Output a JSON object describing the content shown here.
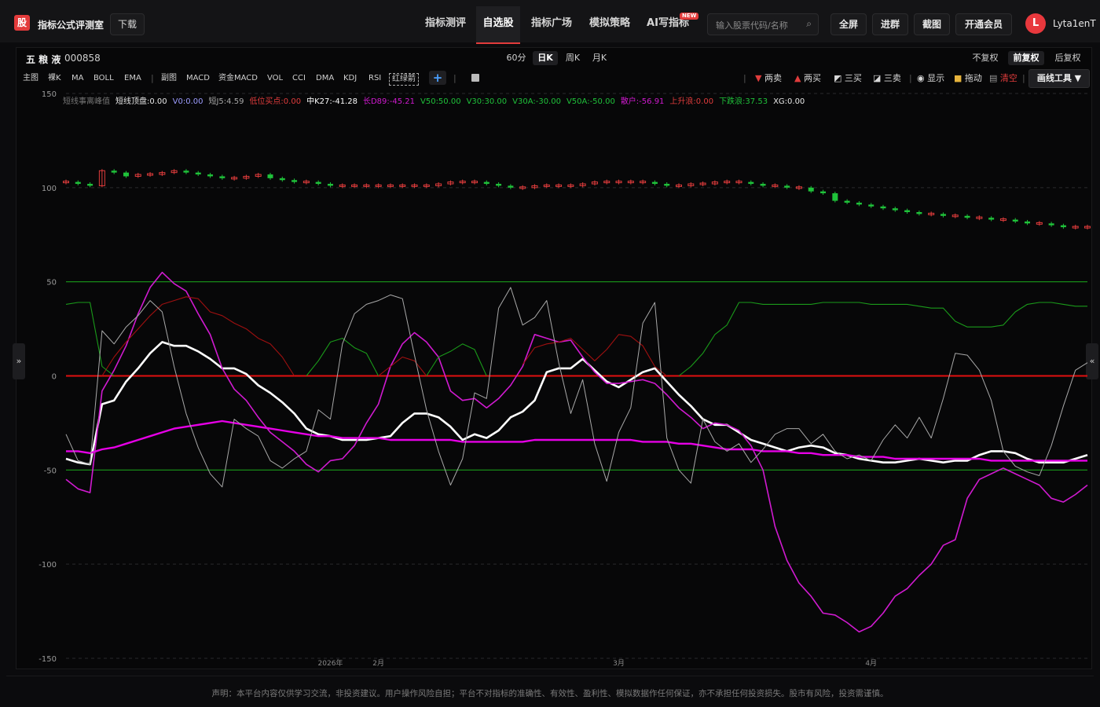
{
  "app": {
    "logo_char": "股",
    "title": "指标公式评测室",
    "download": "下载"
  },
  "nav": {
    "items": [
      "指标测评",
      "自选股",
      "指标广场",
      "模拟策略",
      "AI写指标"
    ],
    "active_index": 1,
    "new_badge": "NEW"
  },
  "search": {
    "placeholder": "输入股票代码/名称"
  },
  "toolbar": {
    "fullscreen": "全屏",
    "join_group": "进群",
    "screenshot": "截图",
    "membership": "开通会员"
  },
  "user": {
    "initial": "L",
    "name": "Lyta1enT"
  },
  "stock": {
    "name": "五 粮 液",
    "code": "000858"
  },
  "periods": {
    "items": [
      "60分",
      "日K",
      "周K",
      "月K"
    ],
    "active_index": 1
  },
  "adjust": {
    "items": [
      "不复权",
      "前复权",
      "后复权"
    ],
    "active_index": 1
  },
  "indicators": {
    "main": [
      "主图",
      "裸K",
      "MA",
      "BOLL",
      "EMA"
    ],
    "sub": [
      "副图",
      "MACD",
      "资金MACD",
      "VOL",
      "CCI",
      "DMA",
      "KDJ",
      "RSI",
      "红绿箭"
    ],
    "add": "+"
  },
  "tools": {
    "items": [
      "两卖",
      "两买",
      "三买",
      "三卖",
      "显示",
      "拖动",
      "清空"
    ],
    "draw": "画线工具 ▼"
  },
  "side": {
    "left": "»",
    "right": "«"
  },
  "colors": {
    "up": "#e03c3c",
    "down": "#1fc23a",
    "white": "#ffffff",
    "magenta": "#d01ad0",
    "pinkline": "#e600e6",
    "darkred": "#a01010",
    "green": "#1a9a1a",
    "grey": "#a8a8a8",
    "bg": "#070708"
  },
  "legend": [
    {
      "text": "短线事离峰值",
      "color": "#777777"
    },
    {
      "text": "短线顶盘:0.00",
      "color": "#e8e8e8"
    },
    {
      "text": "V0:0.00",
      "color": "#9d9dff"
    },
    {
      "text": "短J5:4.59",
      "color": "#a8a8a8"
    },
    {
      "text": "低位买点:0.00",
      "color": "#e03c3c"
    },
    {
      "text": "中K27:-41.28",
      "color": "#ffffff"
    },
    {
      "text": "长D89:-45.21",
      "color": "#d01ad0"
    },
    {
      "text": "V50:50.00",
      "color": "#1fc23a"
    },
    {
      "text": "V30:30.00",
      "color": "#1fc23a"
    },
    {
      "text": "V30A:-30.00",
      "color": "#1fc23a"
    },
    {
      "text": "V50A:-50.00",
      "color": "#1fc23a"
    },
    {
      "text": "散户:-56.91",
      "color": "#d01ad0"
    },
    {
      "text": "上升浪:0.00",
      "color": "#e03c3c"
    },
    {
      "text": "下跌浪:37.53",
      "color": "#1fc23a"
    },
    {
      "text": "XG:0.00",
      "color": "#e8e8e8"
    }
  ],
  "chart_data": {
    "type": "line",
    "ylim": [
      -150,
      150
    ],
    "yticks": [
      150,
      100,
      50,
      0,
      -50,
      -100,
      -150
    ],
    "xlabels": [
      "2026年",
      "2月",
      "3月",
      "4月"
    ],
    "xlabel_positions": [
      22,
      26,
      46,
      67
    ],
    "n": 75,
    "candles": [
      103,
      102,
      101,
      109,
      108,
      106,
      107,
      107,
      108,
      109,
      108,
      107,
      106,
      105,
      105,
      106,
      107,
      105,
      104,
      103,
      103,
      102,
      101,
      101,
      101,
      101,
      101,
      101,
      101,
      101,
      101,
      102,
      103,
      103,
      103,
      102,
      101,
      100,
      100,
      101,
      101,
      101,
      101,
      102,
      103,
      103,
      103,
      103,
      103,
      102,
      101,
      101,
      102,
      102,
      103,
      103,
      103,
      102,
      101,
      101,
      100,
      100,
      98,
      97,
      93,
      92,
      91,
      90,
      89,
      88,
      87,
      86,
      86,
      85,
      85,
      84,
      84,
      83,
      83,
      82,
      81,
      81,
      80,
      79,
      79,
      79
    ],
    "series": [
      {
        "key": "white",
        "values": [
          -44,
          -46,
          -47,
          -15,
          -13,
          -3,
          4,
          12,
          18,
          16,
          16,
          13,
          9,
          4,
          4,
          1,
          -5,
          -9,
          -14,
          -20,
          -28,
          -31,
          -32,
          -34,
          -34,
          -34,
          -33,
          -32,
          -25,
          -20,
          -20,
          -22,
          -27,
          -34,
          -31,
          -33,
          -29,
          -22,
          -19,
          -13,
          2,
          4,
          4,
          9,
          3,
          -3,
          -6,
          -2,
          2,
          4,
          -3,
          -10,
          -16,
          -23,
          -26,
          -26,
          -30,
          -34,
          -36,
          -38,
          -40,
          -38,
          -37,
          -38,
          -41,
          -42,
          -44,
          -45,
          -46,
          -46,
          -45,
          -44,
          -45,
          -46,
          -45,
          -45,
          -42,
          -40,
          -40,
          -41,
          -44,
          -46,
          -46,
          -46,
          -44,
          -42
        ]
      },
      {
        "key": "pinkline",
        "values": [
          -40,
          -40,
          -41,
          -39,
          -38,
          -36,
          -34,
          -32,
          -30,
          -28,
          -27,
          -26,
          -25,
          -24,
          -25,
          -26,
          -27,
          -28,
          -29,
          -30,
          -31,
          -32,
          -32,
          -33,
          -33,
          -33,
          -33,
          -34,
          -34,
          -34,
          -34,
          -34,
          -34,
          -35,
          -35,
          -35,
          -35,
          -35,
          -35,
          -34,
          -34,
          -34,
          -34,
          -34,
          -34,
          -34,
          -34,
          -34,
          -35,
          -35,
          -35,
          -36,
          -36,
          -37,
          -38,
          -39,
          -39,
          -39,
          -40,
          -40,
          -40,
          -41,
          -41,
          -42,
          -42,
          -42,
          -43,
          -43,
          -43,
          -44,
          -44,
          -44,
          -44,
          -44,
          -44,
          -44,
          -44,
          -45,
          -45,
          -45,
          -45,
          -45,
          -45,
          -45,
          -45,
          -45
        ]
      },
      {
        "key": "magenta",
        "values": [
          -55,
          -60,
          -62,
          -8,
          3,
          16,
          33,
          47,
          55,
          49,
          45,
          33,
          22,
          4,
          -7,
          -13,
          -22,
          -30,
          -35,
          -40,
          -47,
          -51,
          -45,
          -44,
          -37,
          -25,
          -15,
          5,
          17,
          23,
          18,
          10,
          -8,
          -13,
          -12,
          -17,
          -12,
          -5,
          5,
          22,
          20,
          18,
          19,
          10,
          2,
          -4,
          -4,
          -3,
          -2,
          -4,
          -10,
          -17,
          -22,
          -28,
          -25,
          -26,
          -29,
          -37,
          -50,
          -80,
          -98,
          -110,
          -117,
          -126,
          -127,
          -131,
          -136,
          -133,
          -126,
          -117,
          -113,
          -106,
          -100,
          -90,
          -87,
          -65,
          -55,
          -52,
          -49,
          -52,
          -55,
          -58,
          -65,
          -67,
          -63,
          -58
        ]
      },
      {
        "key": "darkred",
        "values": [
          null,
          null,
          null,
          0,
          10,
          18,
          25,
          32,
          38,
          40,
          42,
          41,
          34,
          32,
          28,
          25,
          20,
          17,
          10,
          0,
          null,
          null,
          null,
          null,
          null,
          null,
          0,
          5,
          10,
          8,
          0,
          null,
          null,
          null,
          null,
          null,
          null,
          null,
          6,
          15,
          17,
          18,
          20,
          14,
          8,
          14,
          22,
          21,
          16,
          5,
          0,
          null,
          null,
          null,
          null,
          null,
          null,
          null,
          null,
          null,
          null,
          null,
          null,
          null,
          null,
          null,
          null,
          null,
          null,
          null,
          null,
          null,
          null,
          null,
          null,
          null,
          null,
          null,
          null,
          null,
          null,
          null,
          null,
          null,
          null,
          null
        ]
      },
      {
        "key": "green",
        "values": [
          38,
          39,
          39,
          5,
          0,
          null,
          null,
          null,
          null,
          null,
          null,
          null,
          null,
          null,
          null,
          null,
          null,
          null,
          null,
          null,
          0,
          8,
          18,
          20,
          15,
          12,
          0,
          null,
          null,
          null,
          0,
          10,
          13,
          17,
          14,
          0,
          null,
          null,
          null,
          null,
          null,
          null,
          null,
          null,
          null,
          null,
          null,
          null,
          null,
          null,
          null,
          0,
          5,
          12,
          22,
          27,
          39,
          39,
          38,
          38,
          38,
          38,
          38,
          39,
          39,
          39,
          39,
          38,
          38,
          38,
          38,
          37,
          36,
          36,
          29,
          26,
          26,
          26,
          27,
          34,
          38,
          39,
          39,
          38,
          37,
          37
        ]
      },
      {
        "key": "grey",
        "values": [
          -31,
          -45,
          -47,
          24,
          17,
          26,
          32,
          40,
          34,
          5,
          -20,
          -38,
          -52,
          -59,
          -23,
          -28,
          -32,
          -45,
          -49,
          -44,
          -40,
          -18,
          -23,
          17,
          33,
          38,
          40,
          43,
          41,
          11,
          -18,
          -40,
          -58,
          -44,
          -9,
          -12,
          36,
          47,
          27,
          31,
          40,
          7,
          -20,
          -2,
          -36,
          -56,
          -30,
          -17,
          28,
          39,
          -33,
          -50,
          -57,
          -23,
          -35,
          -40,
          -36,
          -46,
          -39,
          -31,
          -28,
          -28,
          -36,
          -31,
          -40,
          -44,
          -42,
          -45,
          -34,
          -26,
          -33,
          -22,
          -33,
          -12,
          12,
          11,
          3,
          -13,
          -40,
          -48,
          -51,
          -53,
          -37,
          -16,
          3,
          7
        ]
      }
    ]
  },
  "disclaimer": "声明：本平台内容仅供学习交流，非投资建议。用户操作风险自担；平台不对指标的准确性、有效性、盈利性、模拟数据作任何保证，亦不承担任何投资损失。股市有风险，投资需谨慎。"
}
